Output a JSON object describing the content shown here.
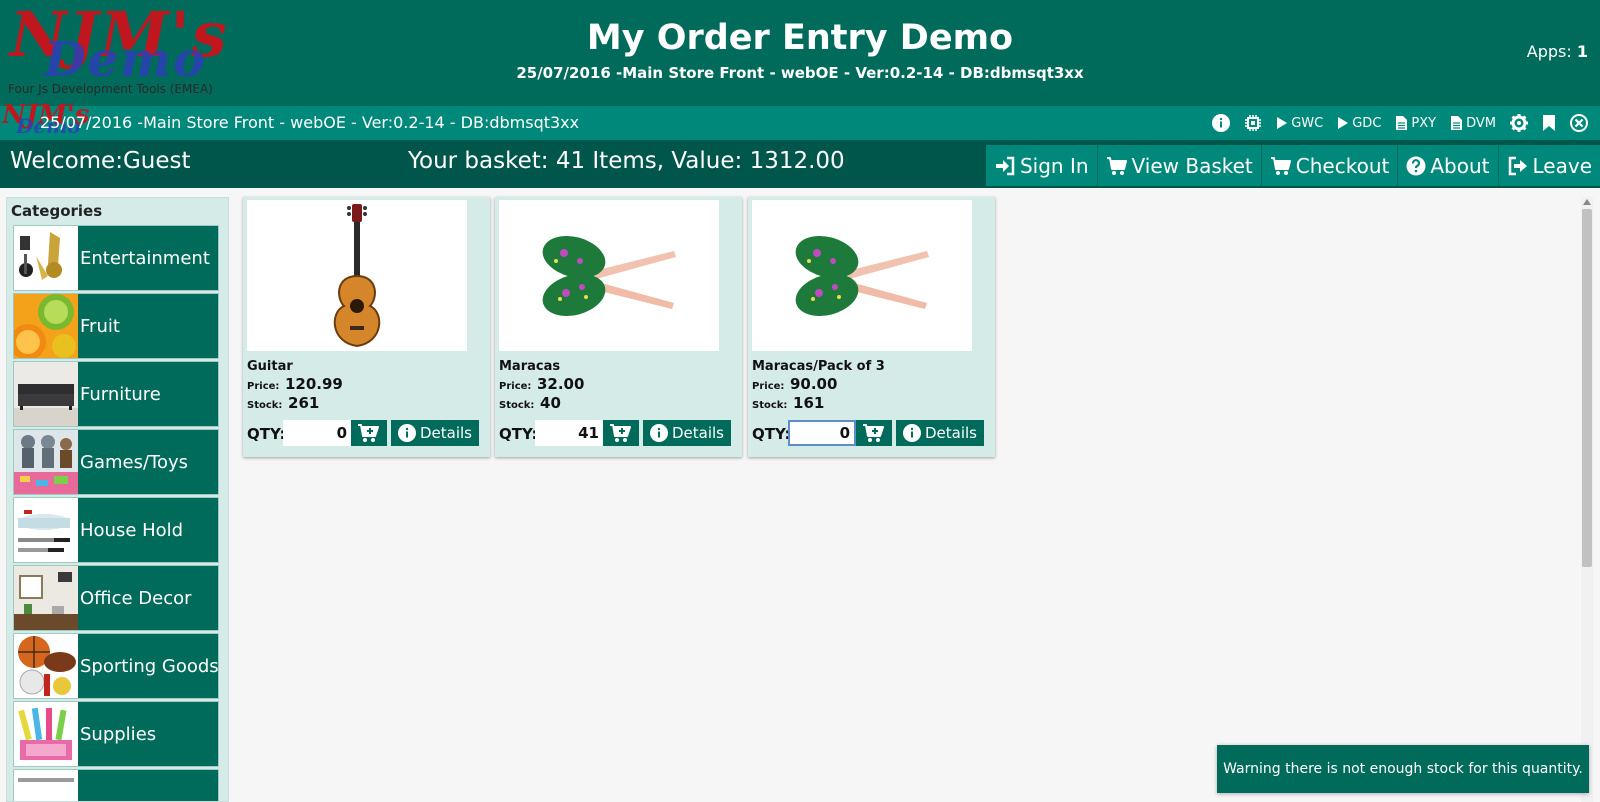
{
  "header": {
    "logo_text_1": "NJM's",
    "logo_text_2": "Demo",
    "logo_caption": "Four Js Development Tools (EMEA)",
    "title": "My Order Entry Demo",
    "subtitle": "25/07/2016 -Main Store Front - webOE - Ver:0.2-14 - DB:dbmsqt3xx",
    "apps_label": "Apps:",
    "apps_count": "1"
  },
  "toolbar": {
    "text": "25/07/2016 -Main Store Front - webOE - Ver:0.2-14 - DB:dbmsqt3xx",
    "items": [
      {
        "icon": "info-icon",
        "label": ""
      },
      {
        "icon": "chip-icon",
        "label": ""
      },
      {
        "icon": "play-icon",
        "label": "GWC"
      },
      {
        "icon": "play-icon",
        "label": "GDC"
      },
      {
        "icon": "file-icon",
        "label": "PXY"
      },
      {
        "icon": "file-icon",
        "label": "DVM"
      },
      {
        "icon": "gear-icon",
        "label": ""
      },
      {
        "icon": "bookmark-icon",
        "label": ""
      },
      {
        "icon": "close-circle-icon",
        "label": ""
      }
    ]
  },
  "navbar": {
    "welcome": "Welcome:Guest",
    "basket": "Your basket: 41 Items, Value: 1312.00",
    "buttons": [
      {
        "icon": "sign-in-icon",
        "label": "Sign In"
      },
      {
        "icon": "cart-icon",
        "label": "View Basket"
      },
      {
        "icon": "cart-icon",
        "label": "Checkout"
      },
      {
        "icon": "question-icon",
        "label": "About"
      },
      {
        "icon": "sign-out-icon",
        "label": "Leave"
      }
    ]
  },
  "sidebar": {
    "title": "Categories",
    "categories": [
      {
        "label": "Entertainment"
      },
      {
        "label": "Fruit"
      },
      {
        "label": "Furniture"
      },
      {
        "label": "Games/Toys"
      },
      {
        "label": "House Hold"
      },
      {
        "label": "Office Decor"
      },
      {
        "label": "Sporting Goods"
      },
      {
        "label": "Supplies"
      }
    ]
  },
  "products": [
    {
      "name": "Guitar",
      "price_label": "Price:",
      "price": "120.99",
      "stock_label": "Stock:",
      "stock": "261",
      "qty_label": "QTY:",
      "qty": "0",
      "details_label": "Details"
    },
    {
      "name": "Maracas",
      "price_label": "Price:",
      "price": "32.00",
      "stock_label": "Stock:",
      "stock": "40",
      "qty_label": "QTY:",
      "qty": "41",
      "details_label": "Details"
    },
    {
      "name": "Maracas/Pack of 3",
      "price_label": "Price:",
      "price": "90.00",
      "stock_label": "Stock:",
      "stock": "161",
      "qty_label": "QTY:",
      "qty": "0",
      "details_label": "Details"
    }
  ],
  "toast": {
    "message": "Warning there is not enough stock for this quantity."
  },
  "colors": {
    "header_bg": "#006b5a",
    "toolbar_bg": "#00897b",
    "navbar_bg": "#00564a",
    "card_bg": "#d4ebe8"
  }
}
